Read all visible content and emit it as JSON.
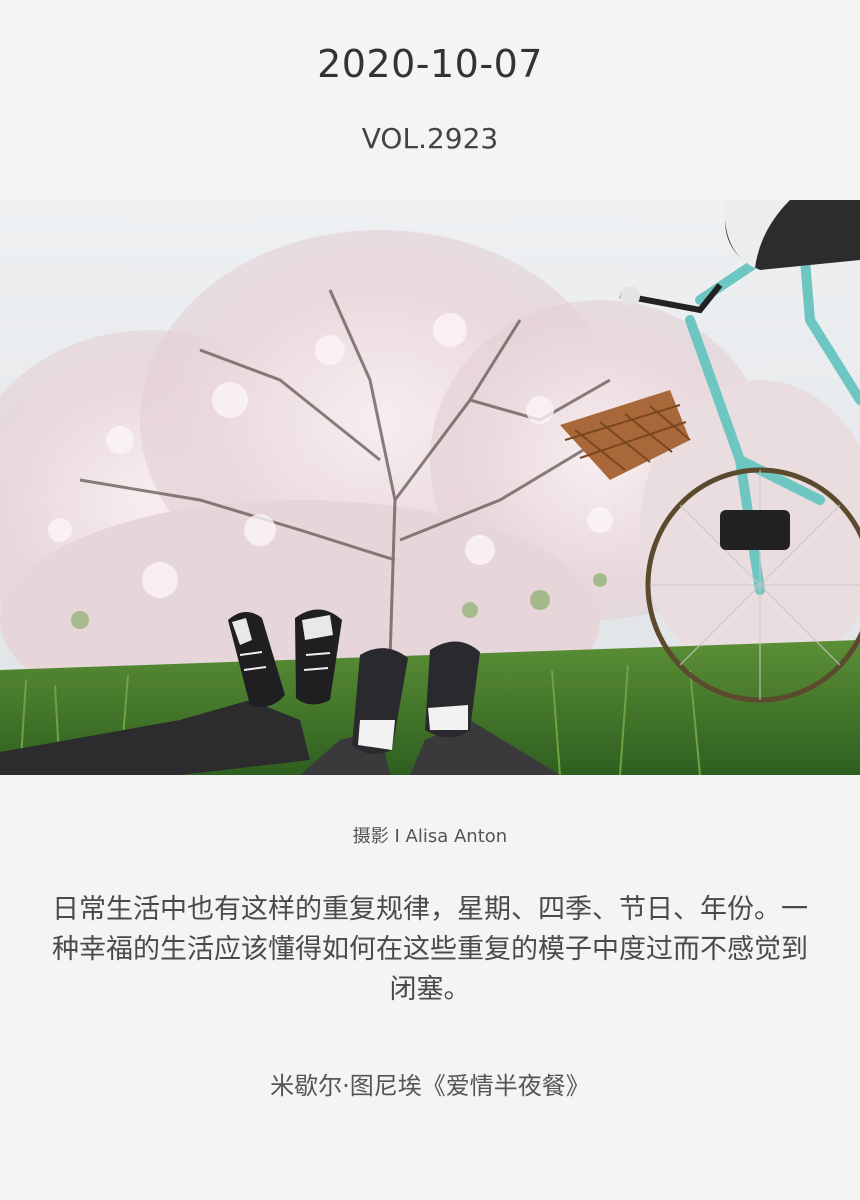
{
  "header": {
    "date": "2020-10-07",
    "volume": "VOL.2923"
  },
  "photo": {
    "subject": "blossom-tree-bicycle-sneakers",
    "credit": "摄影 I Alisa Anton"
  },
  "quote": {
    "text": "日常生活中也有这样的重复规律，星期、四季、节日、年份。一种幸福的生活应该懂得如何在这些重复的模子中度过而不感觉到闭塞。",
    "source": "米歇尔·图尼埃《爱情半夜餐》"
  },
  "colors": {
    "background": "#f4f4f4",
    "text": "#333333",
    "bicycle": "#6ec6c2",
    "grass": "#3f7d2a"
  }
}
